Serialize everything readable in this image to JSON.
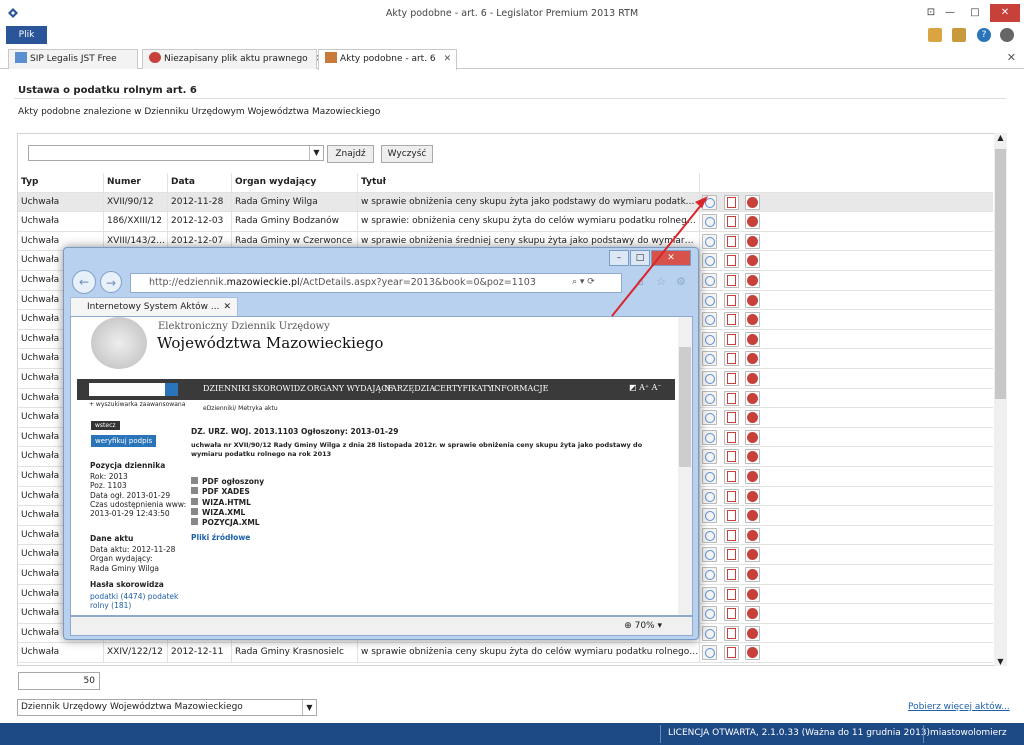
{
  "window": {
    "title": "Akty podobne - art. 6 - Legislator Premium 2013 RTM"
  },
  "ribbon": {
    "file_label": "Plik"
  },
  "tabs": [
    {
      "label": "SIP Legalis JST Free"
    },
    {
      "label": "Niezapisany plik aktu prawnego"
    },
    {
      "label": "Akty podobne - art. 6"
    }
  ],
  "page": {
    "heading": "Ustawa o podatku rolnym art. 6",
    "subheading": "Akty podobne znalezione w Dzienniku Urzędowym Województwa Mazowieckiego",
    "search_value": "",
    "find_label": "Znajdź",
    "clear_label": "Wyczyść",
    "page_size": "50",
    "source_select": "Dziennik Urzędowy Województwa Mazowieckiego",
    "more_link": "Pobierz więcej aktów..."
  },
  "table": {
    "headers": [
      "Typ",
      "Numer",
      "Data",
      "Organ wydający",
      "Tytuł"
    ],
    "rows": [
      {
        "typ": "Uchwała",
        "numer": "XVII/90/12",
        "data": "2012-11-28",
        "organ": "Rada Gminy Wilga",
        "tytul": "w sprawie obniżenia ceny skupu żyta jako podstawy do wymiaru podatku rolne..."
      },
      {
        "typ": "Uchwała",
        "numer": "186/XXIII/12",
        "data": "2012-12-03",
        "organ": "Rada Gminy Bodzanów",
        "tytul": "w sprawie: obniżenia ceny skupu żyta do celów wymiaru podatku rolnego na ro..."
      },
      {
        "typ": "Uchwała",
        "numer": "XVIII/143/2...",
        "data": "2012-12-07",
        "organ": "Rada Gminy w Czerwonce",
        "tytul": "w sprawie obniżenia średniej ceny skupu żyta jako podstawy do wymiaru podatk..."
      },
      {
        "typ": "Uchwała",
        "numer": "",
        "data": "",
        "organ": "",
        "tytul": ""
      },
      {
        "typ": "Uchwała",
        "numer": "",
        "data": "",
        "organ": "",
        "tytul": ""
      },
      {
        "typ": "Uchwała",
        "numer": "",
        "data": "",
        "organ": "",
        "tytul": ""
      },
      {
        "typ": "Uchwała",
        "numer": "",
        "data": "",
        "organ": "",
        "tytul": ""
      },
      {
        "typ": "Uchwała",
        "numer": "",
        "data": "",
        "organ": "",
        "tytul": ""
      },
      {
        "typ": "Uchwała",
        "numer": "",
        "data": "",
        "organ": "",
        "tytul": ""
      },
      {
        "typ": "Uchwała",
        "numer": "",
        "data": "",
        "organ": "",
        "tytul": ""
      },
      {
        "typ": "Uchwała",
        "numer": "",
        "data": "",
        "organ": "",
        "tytul": ""
      },
      {
        "typ": "Uchwała",
        "numer": "",
        "data": "",
        "organ": "",
        "tytul": ""
      },
      {
        "typ": "Uchwała",
        "numer": "",
        "data": "",
        "organ": "",
        "tytul": ""
      },
      {
        "typ": "Uchwała",
        "numer": "",
        "data": "",
        "organ": "",
        "tytul": ""
      },
      {
        "typ": "Uchwała",
        "numer": "",
        "data": "",
        "organ": "",
        "tytul": ""
      },
      {
        "typ": "Uchwała",
        "numer": "",
        "data": "",
        "organ": "",
        "tytul": ""
      },
      {
        "typ": "Uchwała",
        "numer": "",
        "data": "",
        "organ": "",
        "tytul": ""
      },
      {
        "typ": "Uchwała",
        "numer": "",
        "data": "",
        "organ": "",
        "tytul": ""
      },
      {
        "typ": "Uchwała",
        "numer": "",
        "data": "",
        "organ": "",
        "tytul": ""
      },
      {
        "typ": "Uchwała",
        "numer": "",
        "data": "",
        "organ": "",
        "tytul": ""
      },
      {
        "typ": "Uchwała",
        "numer": "",
        "data": "",
        "organ": "",
        "tytul": ""
      },
      {
        "typ": "Uchwała",
        "numer": "",
        "data": "",
        "organ": "",
        "tytul": ""
      },
      {
        "typ": "Uchwała",
        "numer": "",
        "data": "",
        "organ": "",
        "tytul": ""
      },
      {
        "typ": "Uchwała",
        "numer": "XXIV/122/12",
        "data": "2012-12-11",
        "organ": "Rada Gminy Krasnosielc",
        "tytul": "w sprawie obniżenia ceny skupu żyta do celów wymiaru podatku rolnego na 201..."
      }
    ]
  },
  "status": {
    "license": "LICENCJA OTWARTA, 2.1.0.33 (Ważna do 11 grudnia 2013)",
    "user": "miastowolomierz"
  },
  "browser": {
    "url_prefix": "http://edziennik.",
    "url_domain": "mazowieckie.pl",
    "url_suffix": "/ActDetails.aspx?year=2013&book=0&poz=1103",
    "tab_label": "Internetowy System Aktów ...",
    "zoom": "70%",
    "site_title1": "Elektroniczny Dziennik Urzędowy",
    "site_title2": "Województwa Mazowieckiego",
    "nav_items": [
      "DZIENNIKI",
      "SKOROWIDZ",
      "ORGANY WYDAJĄCE",
      "NARZĘDZIA",
      "CERTYFIKATY",
      "INFORMACJE"
    ],
    "adv_search": "+ wyszukiwarka zaawansowana",
    "breadcrumb": "eDzienniki/ Metryka aktu",
    "back_label": "wstecz",
    "verify_label": "weryfikuj podpis",
    "pos_title": "Pozycja dziennika",
    "pos_lines": [
      "Rok: 2013",
      "Poz. 1103",
      "Data ogł. 2013-01-29",
      "Czas udostępnienia www:",
      "2013-01-29 12:43:50"
    ],
    "act_title": "Dane aktu",
    "act_lines": [
      "Data aktu: 2012-11-28",
      "Organ wydający:",
      "Rada Gminy Wilga"
    ],
    "tags_title": "Hasła skorowidza",
    "tags_line1": "podatki (4474)   podatek",
    "tags_line2": "rolny (181)",
    "doc_header": "DZ. URZ. WOJ. 2013.1103      Ogłoszony: 2013-01-29",
    "doc_desc1": "uchwała nr XVII/90/12 Rady Gminy Wilga z dnia 28 listopada 2012r. w sprawie obniżenia ceny skupu żyta jako podstawy do",
    "doc_desc2": "wymiaru podatku rolnego na rok 2013",
    "files": [
      "PDF ogłoszony",
      "PDF XADES",
      "WIZA.HTML",
      "WIZA.XML",
      "POZYCJA.XML"
    ],
    "sources_link": "Pliki źródłowe"
  },
  "colors": {
    "accent": "#2a5699",
    "status_bar": "#1d4a85",
    "close": "#c7403a",
    "arrow": "#d9262a"
  }
}
